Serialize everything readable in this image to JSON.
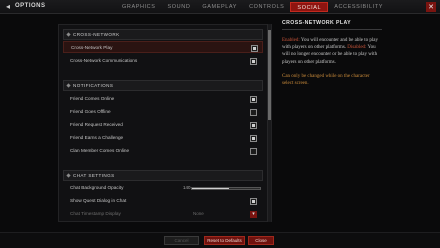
{
  "window": {
    "title": "OPTIONS"
  },
  "tabs": [
    {
      "label": "GRAPHICS"
    },
    {
      "label": "SOUND"
    },
    {
      "label": "GAMEPLAY"
    },
    {
      "label": "CONTROLS"
    },
    {
      "label": "SOCIAL",
      "active": true
    },
    {
      "label": "ACCESSIBILITY"
    }
  ],
  "sections": {
    "cross_network": {
      "header": "CROSS-NETWORK",
      "items": [
        {
          "label": "Cross-Network Play",
          "checked": true
        },
        {
          "label": "Cross-Network Communications",
          "checked": true
        }
      ]
    },
    "notifications": {
      "header": "NOTIFICATIONS",
      "items": [
        {
          "label": "Friend Comes Online",
          "checked": true
        },
        {
          "label": "Friend Goes Offline",
          "checked": false
        },
        {
          "label": "Friend Request Received",
          "checked": true
        },
        {
          "label": "Friend Earns a Challenge",
          "checked": true
        },
        {
          "label": "Clan Member Comes Online",
          "checked": false
        }
      ]
    },
    "chat": {
      "header": "CHAT SETTINGS",
      "background_opacity": {
        "label": "Chat Background Opacity",
        "value": "140",
        "fraction": 0.55
      },
      "quest_dialog": {
        "label": "Show Quest Dialog in Chat",
        "checked": true
      },
      "timestamp": {
        "label": "Chat Timestamp Display",
        "value": "None"
      }
    }
  },
  "info": {
    "title": "CROSS-NETWORK PLAY",
    "enabled_label": "Enabled:",
    "enabled_text": " You will encounter and be able to play with players on other platforms.",
    "disabled_label": "Disabled:",
    "disabled_text": " You will no longer encounter or be able to play with players on other platforms.",
    "note": "Can only be changed while on the character select screen."
  },
  "buttons": {
    "cancel": "Cancel",
    "reset": "Reset to Defaults",
    "close": "Close"
  },
  "colors": {
    "accent": "#8e1410",
    "highlight": "#c9553a",
    "note": "#c98a3a"
  }
}
